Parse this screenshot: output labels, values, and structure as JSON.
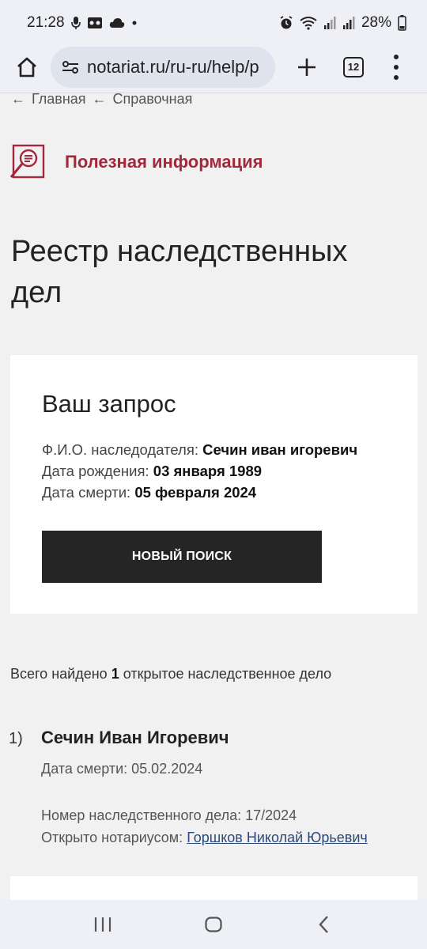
{
  "status": {
    "time": "21:28",
    "battery": "28%"
  },
  "browser": {
    "url": "notariat.ru/ru-ru/help/p",
    "tab_count": "12"
  },
  "breadcrumb": {
    "items": [
      "Главная",
      "Справочная"
    ]
  },
  "section": {
    "title": "Полезная информация"
  },
  "page": {
    "title": "Реестр наследственных дел"
  },
  "request_card": {
    "title": "Ваш запрос",
    "name_label": "Ф.И.О. наследодателя:",
    "name_value": "Сечин иван игоревич",
    "birth_label": "Дата рождения:",
    "birth_value": "03 января 1989",
    "death_label": "Дата смерти:",
    "death_value": "05 февраля 2024",
    "new_search_label": "НОВЫЙ ПОИСК"
  },
  "results": {
    "found_prefix": "Всего найдено",
    "found_count": "1",
    "found_suffix": "открытое наследственное дело",
    "items": [
      {
        "index": "1)",
        "name": "Сечин Иван Игоревич",
        "death_date": "Дата смерти: 05.02.2024",
        "case_number": "Номер наследственного дела: 17/2024",
        "notary_label": "Открыто нотариусом:",
        "notary_name": "Горшков Николай Юрьевич"
      }
    ]
  },
  "colors": {
    "accent": "#a3283c",
    "button": "#252525",
    "link": "#2b4a7a"
  }
}
